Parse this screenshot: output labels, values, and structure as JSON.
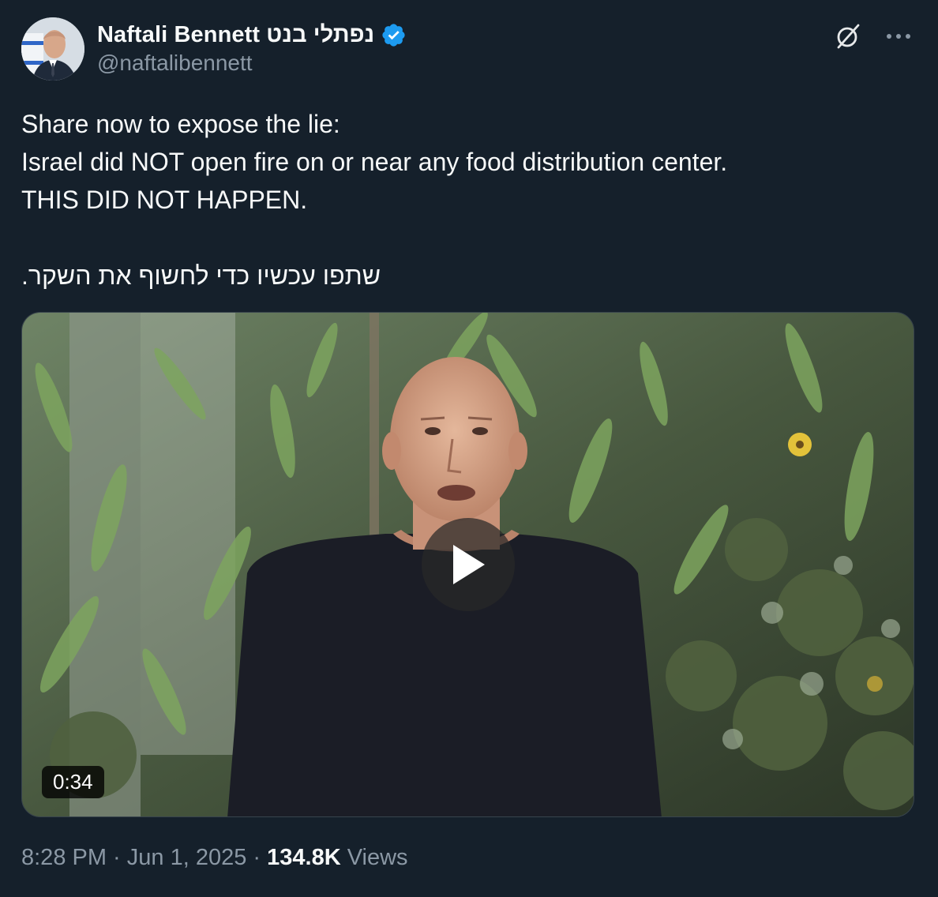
{
  "author": {
    "display_name": "Naftali Bennett נפתלי בנט",
    "handle": "@naftalibennett"
  },
  "icons": {
    "verified": "verified-badge-icon",
    "grok": "grok-icon",
    "more": "more-options-icon",
    "play": "play-icon"
  },
  "colors": {
    "background": "#15202b",
    "text": "#f7f9f9",
    "secondary": "#8b98a5",
    "verified": "#1d9bf0"
  },
  "tweet": {
    "line1": "Share now to expose the lie:",
    "line2": "Israel did NOT open fire on or near any food distribution center.",
    "line3": "THIS DID NOT HAPPEN.",
    "line4": "שתפו עכשיו כדי לחשוף את השקר."
  },
  "media": {
    "duration": "0:34"
  },
  "meta": {
    "time": "8:28 PM",
    "separator": " · ",
    "date": "Jun 1, 2025",
    "views_count": "134.8K",
    "views_label": " Views"
  }
}
